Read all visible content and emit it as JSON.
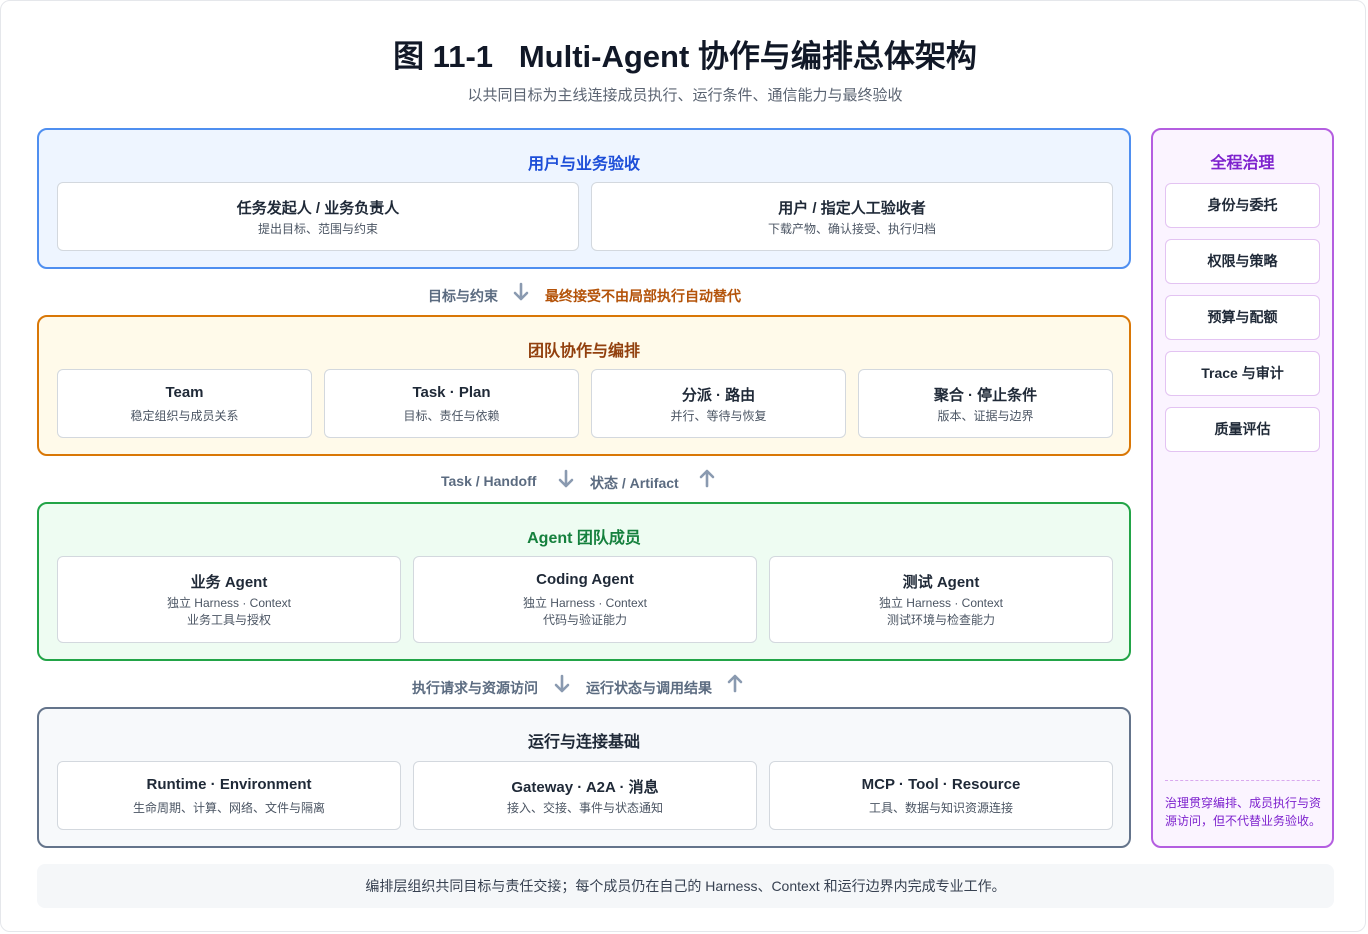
{
  "header": {
    "title": "图 11-1   Multi-Agent 协作与编排总体架构",
    "subtitle": "以共同目标为主线连接成员执行、运行条件、通信能力与最终验收"
  },
  "layers": {
    "users": {
      "title": "用户与业务验收",
      "cards": [
        {
          "title": "任务发起人 / 业务负责人",
          "sub": "提出目标、范围与约束"
        },
        {
          "title": "用户 / 指定人工验收者",
          "sub": "下载产物、确认接受、执行归档"
        }
      ]
    },
    "team": {
      "title": "团队协作与编排",
      "cards": [
        {
          "title": "Team",
          "sub": "稳定组织与成员关系"
        },
        {
          "title": "Task · Plan",
          "sub": "目标、责任与依赖"
        },
        {
          "title": "分派 · 路由",
          "sub": "并行、等待与恢复"
        },
        {
          "title": "聚合 · 停止条件",
          "sub": "版本、证据与边界"
        }
      ]
    },
    "agents": {
      "title": "Agent 团队成员",
      "cards": [
        {
          "title": "业务 Agent",
          "sub1": "独立 Harness · Context",
          "sub2": "业务工具与授权"
        },
        {
          "title": "Coding Agent",
          "sub1": "独立 Harness · Context",
          "sub2": "代码与验证能力"
        },
        {
          "title": "测试 Agent",
          "sub1": "独立 Harness · Context",
          "sub2": "测试环境与检查能力"
        }
      ]
    },
    "runtime": {
      "title": "运行与连接基础",
      "cards": [
        {
          "title": "Runtime · Environment",
          "sub": "生命周期、计算、网络、文件与隔离"
        },
        {
          "title": "Gateway · A2A · 消息",
          "sub": "接入、交接、事件与状态通知"
        },
        {
          "title": "MCP · Tool · Resource",
          "sub": "工具、数据与知识资源连接"
        }
      ]
    }
  },
  "flows": {
    "users_team": {
      "down_label": "目标与约束",
      "note": "最终接受不由局部执行自动替代"
    },
    "team_agents": {
      "down_label": "Task / Handoff",
      "up_label": "状态 / Artifact"
    },
    "agents_runtime": {
      "down_label": "执行请求与资源访问",
      "up_label": "运行状态与调用结果"
    }
  },
  "governance": {
    "title": "全程治理",
    "items": [
      "身份与委托",
      "权限与策略",
      "预算与配额",
      "Trace 与审计",
      "质量评估"
    ],
    "note": "治理贯穿编排、成员执行与资源访问，但不代替业务验收。"
  },
  "footer": {
    "text": "编排层组织共同目标与责任交接；每个成员仍在自己的 Harness、Context 和运行边界内完成专业工作。"
  },
  "colors": {
    "users_accent": "#4f8ff0",
    "team_accent": "#d97706",
    "agents_accent": "#22a447",
    "runtime_accent": "#64748b",
    "governance_accent": "#b45ee0",
    "warning_text": "#b45309",
    "arrow": "#8a9ab0"
  },
  "icons": {
    "down": "arrow-down-icon",
    "up": "arrow-up-icon"
  }
}
